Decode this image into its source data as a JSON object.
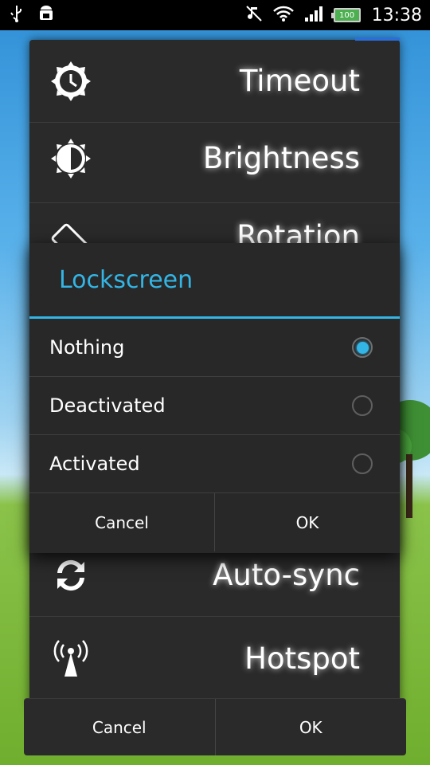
{
  "status_bar": {
    "icons": [
      "usb-icon",
      "android-debug-icon",
      "mute-icon",
      "wifi-icon",
      "signal-icon"
    ],
    "battery": "100",
    "time": "13:38"
  },
  "settings_list": [
    {
      "label": "Timeout",
      "icon": "timeout-icon"
    },
    {
      "label": "Brightness",
      "icon": "brightness-icon"
    },
    {
      "label": "Rotation",
      "icon": "rotation-icon"
    },
    {
      "label": "Auto-sync",
      "icon": "sync-icon"
    },
    {
      "label": "Hotspot",
      "icon": "hotspot-icon"
    }
  ],
  "back_buttons": {
    "cancel": "Cancel",
    "ok": "OK"
  },
  "dialog": {
    "title": "Lockscreen",
    "options": [
      {
        "label": "Nothing",
        "selected": true
      },
      {
        "label": "Deactivated",
        "selected": false
      },
      {
        "label": "Activated",
        "selected": false
      }
    ],
    "cancel": "Cancel",
    "ok": "OK"
  },
  "colors": {
    "accent": "#33b5e5",
    "panel": "#2a2a2a"
  }
}
